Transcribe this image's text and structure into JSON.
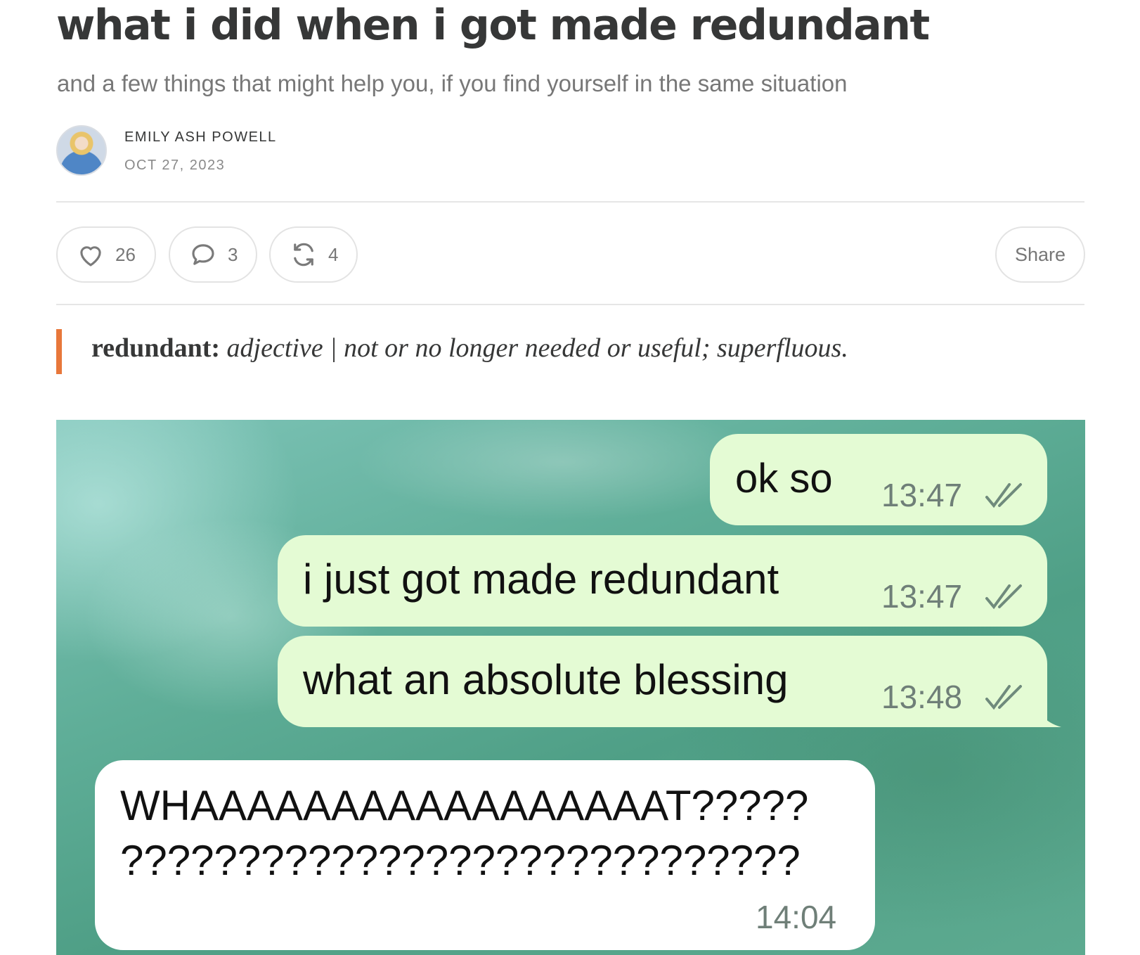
{
  "article": {
    "title": "what i did when i got made redundant",
    "subtitle": "and a few things that might help you, if you find yourself in the same situation",
    "author": "EMILY ASH POWELL",
    "date": "OCT 27, 2023"
  },
  "actions": {
    "likes": "26",
    "comments": "3",
    "restacks": "4",
    "share_label": "Share"
  },
  "quote": {
    "term": "redundant:",
    "definition": " adjective | not or no longer needed or useful; superfluous."
  },
  "chat": {
    "messages": [
      {
        "text": "ok so",
        "time": "13:47",
        "direction": "outgoing",
        "status": "read"
      },
      {
        "text": "i just got made redundant",
        "time": "13:47",
        "direction": "outgoing",
        "status": "read"
      },
      {
        "text": "what an absolute blessing",
        "time": "13:48",
        "direction": "outgoing",
        "status": "read"
      },
      {
        "text_line1": "WHAAAAAAAAAAAAAAAAAT?????",
        "text_line2": "?????????????????????????????",
        "time": "14:04",
        "direction": "incoming"
      }
    ]
  },
  "colors": {
    "accent": "#e8773a",
    "outgoing_bubble": "#e4fbd4",
    "incoming_bubble": "#ffffff"
  }
}
